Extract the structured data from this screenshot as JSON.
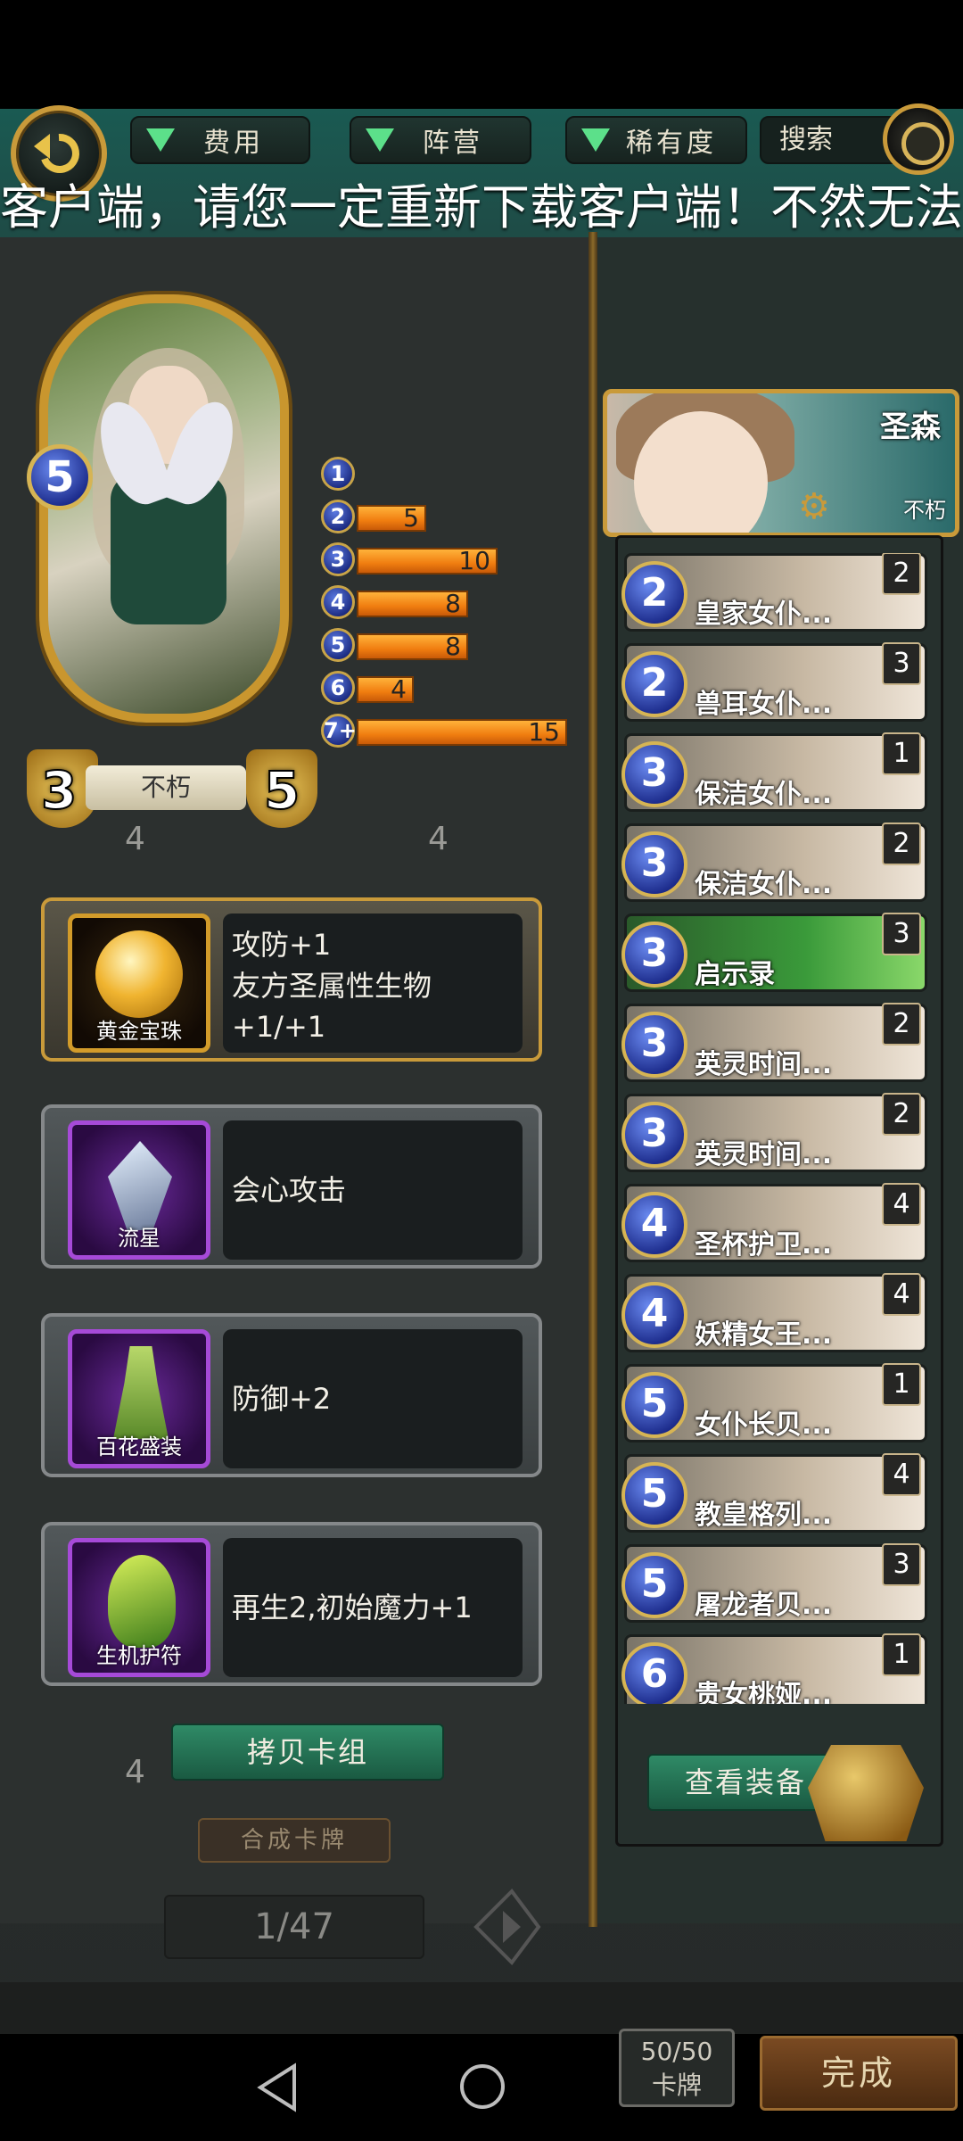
{
  "filters": [
    {
      "label": "费用"
    },
    {
      "label": "阵营"
    },
    {
      "label": "稀有度"
    }
  ],
  "search": {
    "label": "搜索"
  },
  "marquee_text": "客户端，请您一定重新下载客户端！不然无法",
  "hero_card": {
    "cost": "5",
    "attack": "3",
    "health": "5",
    "name": "不朽"
  },
  "mana_curve": [
    {
      "cost": "1",
      "count": "",
      "fill": 0.0
    },
    {
      "cost": "2",
      "count": "5",
      "fill": 0.33
    },
    {
      "cost": "3",
      "count": "10",
      "fill": 0.67
    },
    {
      "cost": "4",
      "count": "8",
      "fill": 0.53
    },
    {
      "cost": "5",
      "count": "8",
      "fill": 0.53
    },
    {
      "cost": "6",
      "count": "4",
      "fill": 0.27
    },
    {
      "cost": "7+",
      "count": "15",
      "fill": 1.0
    }
  ],
  "perks": [
    {
      "icon_label": "黄金宝珠",
      "text": "攻防+1\n友方圣属性生物+1/+1",
      "icon": "golden-orb-icon"
    },
    {
      "icon_label": "流星",
      "text": "会心攻击",
      "icon": "meteor-icon"
    },
    {
      "icon_label": "百花盛装",
      "text": "防御+2",
      "icon": "flower-dress-icon"
    },
    {
      "icon_label": "生机护符",
      "text": "再生2,初始魔力+1",
      "icon": "vitality-amulet-icon"
    }
  ],
  "copy_deck_label": "拷贝卡组",
  "merge_label": "合成卡牌",
  "page_indicator": "1/47",
  "leader": {
    "name": "圣森",
    "subtitle": "不朽"
  },
  "deck_cards": [
    {
      "cost": "2",
      "name": "皇家女仆...",
      "count": "2"
    },
    {
      "cost": "2",
      "name": "兽耳女仆...",
      "count": "3"
    },
    {
      "cost": "3",
      "name": "保洁女仆...",
      "count": "1"
    },
    {
      "cost": "3",
      "name": "保洁女仆...",
      "count": "2"
    },
    {
      "cost": "3",
      "name": "启示录",
      "count": "3"
    },
    {
      "cost": "3",
      "name": "英灵时间...",
      "count": "2"
    },
    {
      "cost": "3",
      "name": "英灵时间...",
      "count": "2"
    },
    {
      "cost": "4",
      "name": "圣杯护卫...",
      "count": "4"
    },
    {
      "cost": "4",
      "name": "妖精女王...",
      "count": "4"
    },
    {
      "cost": "5",
      "name": "女仆长贝...",
      "count": "1"
    },
    {
      "cost": "5",
      "name": "教皇格列...",
      "count": "4"
    },
    {
      "cost": "5",
      "name": "屠龙者贝...",
      "count": "3"
    },
    {
      "cost": "6",
      "name": "贵女桃娅...",
      "count": "1"
    }
  ],
  "view_equipment_label": "查看装备",
  "deck_size": {
    "current": "50/50",
    "label": "卡牌"
  },
  "done_label": "完成",
  "colors": {
    "accent_gold": "#c99a3a",
    "bar_orange": "#f07d10",
    "button_green": "#2f8a66",
    "filter_triangle": "#5ce08a",
    "epic_purple": "#a64ad8"
  }
}
